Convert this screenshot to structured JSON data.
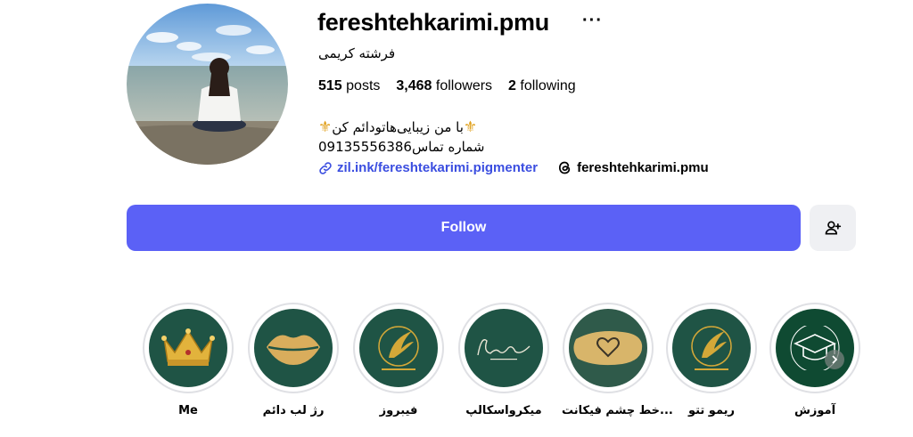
{
  "profile": {
    "username": "fereshtehkarimi.pmu",
    "more_label": "···",
    "full_name": "فرشته کریمی",
    "stats": {
      "posts_count": "515",
      "posts_label": "posts",
      "followers_count": "3,468",
      "followers_label": "followers",
      "following_count": "2",
      "following_label": "following"
    },
    "bio": {
      "line1": "با من زیبایی‌هاتودائم کن",
      "line2": "شماره تماس09135556386",
      "decor_icon": "fleur-de-lis"
    },
    "link_text": "zil.ink/fereshtekarimi.pigmenter",
    "threads_handle": "fereshtehkarimi.pmu"
  },
  "actions": {
    "follow_label": "Follow",
    "suggest_icon": "add-person-icon"
  },
  "colors": {
    "follow_bg": "#5b61f6",
    "link": "#3b4ee0",
    "highlight_bg": "#1f5445",
    "gold": "#d4a838"
  },
  "highlights": [
    {
      "label": "Me",
      "icon": "crown"
    },
    {
      "label": "رژ لب دائم",
      "icon": "lips"
    },
    {
      "label": "فیبروز",
      "icon": "logo-wing"
    },
    {
      "label": "میکرواسکالپ",
      "icon": "signature"
    },
    {
      "label": "خط چشم فیکانت...",
      "icon": "heart"
    },
    {
      "label": "ریمو تتو",
      "icon": "logo-wing"
    },
    {
      "label": "آموزش",
      "icon": "graduation-cap"
    }
  ]
}
